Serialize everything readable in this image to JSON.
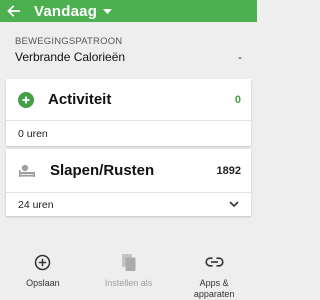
{
  "colors": {
    "primary_green": "#4caf50",
    "accent_green": "#43a047",
    "background": "#eeeeee",
    "card": "#ffffff",
    "disabled": "#9e9e9e"
  },
  "header": {
    "title": "Vandaag",
    "back_icon": "arrow-left-icon",
    "dropdown_icon": "caret-down-icon"
  },
  "movement_pattern": {
    "label": "BEWEGINGSPATROON",
    "value": "Verbrande Calorieën",
    "trailing": "-"
  },
  "cards": {
    "activity": {
      "icon": "plus-circle-icon",
      "title": "Activiteit",
      "value": "0",
      "duration": "0 uren"
    },
    "rest": {
      "icon": "sleep-icon",
      "title": "Slapen/Rusten",
      "value": "1892",
      "duration": "24 uren",
      "expand_icon": "chevron-down-icon"
    }
  },
  "actions": [
    {
      "label": "Opslaan",
      "icon": "add-circle-outline-icon",
      "enabled": true
    },
    {
      "label": "Instellen als",
      "icon": "copy-icon",
      "enabled": false
    },
    {
      "label": "Apps &\napparaten",
      "icon": "link-icon",
      "enabled": true
    }
  ]
}
